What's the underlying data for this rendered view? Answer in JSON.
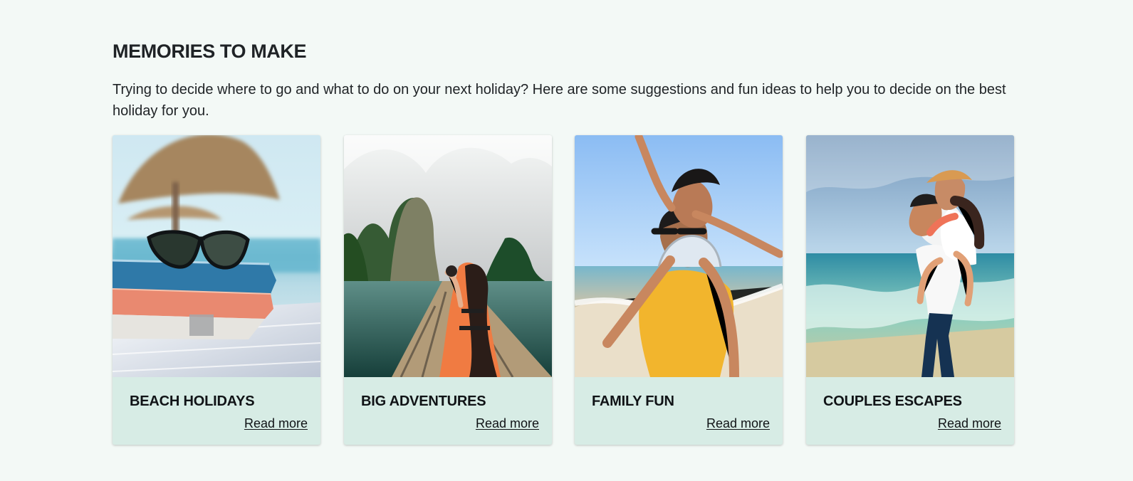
{
  "section": {
    "title": "MEMORIES TO MAKE",
    "description": "Trying to decide where to go and what to do on your next holiday? Here are some suggestions and fun ideas to help you to decide on the best holiday for you."
  },
  "cards": [
    {
      "title": "BEACH HOLIDAYS",
      "link_text": "Read more"
    },
    {
      "title": "BIG ADVENTURES",
      "link_text": "Read more"
    },
    {
      "title": "FAMILY FUN",
      "link_text": "Read more"
    },
    {
      "title": "COUPLES ESCAPES",
      "link_text": "Read more"
    }
  ],
  "colors": {
    "page_background": "#f3f9f6",
    "card_background": "#d7ece5",
    "text": "#1f2326"
  }
}
